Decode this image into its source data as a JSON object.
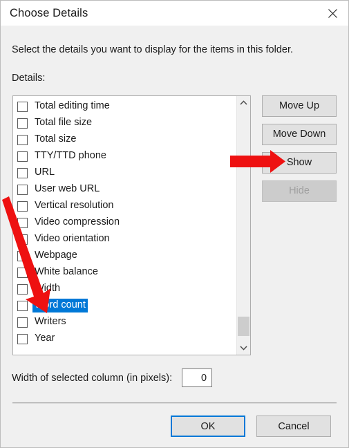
{
  "window": {
    "title": "Choose Details",
    "close_icon": "close-icon"
  },
  "description": "Select the details you want to display for the items in this folder.",
  "details_label": "Details:",
  "list": {
    "items": [
      {
        "label": "Total editing time",
        "checked": false,
        "selected": false
      },
      {
        "label": "Total file size",
        "checked": false,
        "selected": false
      },
      {
        "label": "Total size",
        "checked": false,
        "selected": false
      },
      {
        "label": "TTY/TTD phone",
        "checked": false,
        "selected": false
      },
      {
        "label": "URL",
        "checked": false,
        "selected": false
      },
      {
        "label": "User web URL",
        "checked": false,
        "selected": false
      },
      {
        "label": "Vertical resolution",
        "checked": false,
        "selected": false
      },
      {
        "label": "Video compression",
        "checked": false,
        "selected": false
      },
      {
        "label": "Video orientation",
        "checked": false,
        "selected": false
      },
      {
        "label": "Webpage",
        "checked": false,
        "selected": false
      },
      {
        "label": "White balance",
        "checked": false,
        "selected": false
      },
      {
        "label": "Width",
        "checked": false,
        "selected": false
      },
      {
        "label": "Word count",
        "checked": false,
        "selected": true
      },
      {
        "label": "Writers",
        "checked": false,
        "selected": false
      },
      {
        "label": "Year",
        "checked": false,
        "selected": false
      }
    ],
    "scrollbar": {
      "up_icon": "chevron-up-icon",
      "down_icon": "chevron-down-icon"
    }
  },
  "side_buttons": [
    {
      "label": "Move Up",
      "enabled": true
    },
    {
      "label": "Move Down",
      "enabled": true
    },
    {
      "label": "Show",
      "enabled": true
    },
    {
      "label": "Hide",
      "enabled": false
    }
  ],
  "width_field": {
    "label": "Width of selected column (in pixels):",
    "value": "0"
  },
  "footer": {
    "ok_label": "OK",
    "cancel_label": "Cancel"
  },
  "annotations": {
    "arrow_color": "#ee1111",
    "arrow_show_target": "Show",
    "arrow_item_target": "Word count"
  },
  "colors": {
    "selection": "#0078d7",
    "dialog_background": "#f0f0f0",
    "titlebar_background": "#ffffff",
    "button_face": "#e1e1e1",
    "accent": "#0078d7"
  }
}
